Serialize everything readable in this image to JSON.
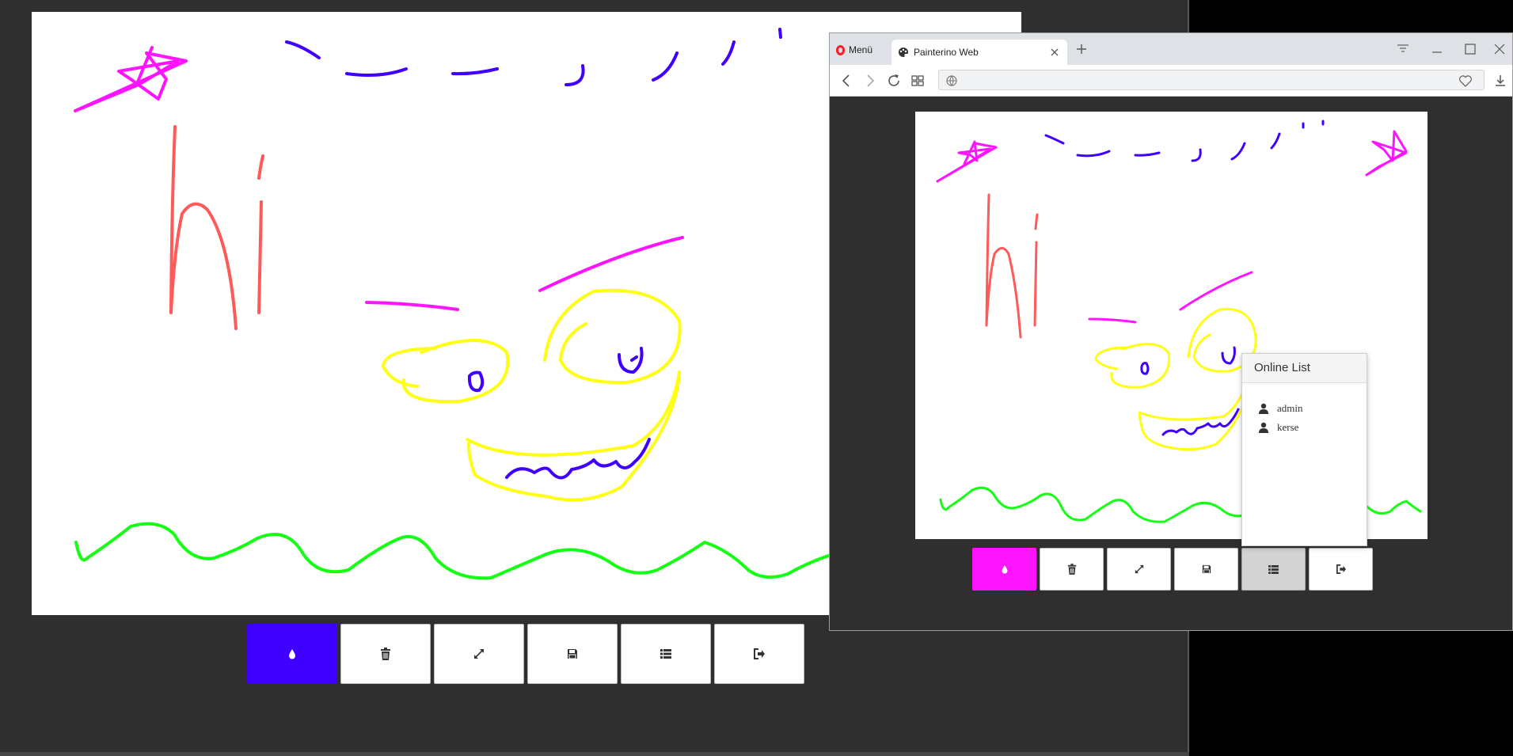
{
  "theme": {
    "left_accent": "#4000ff",
    "right_accent": "#ff14ff",
    "app_background": "#2f2f2f",
    "canvas_background": "#ffffff"
  },
  "left_app": {
    "toolbar": [
      {
        "icon": "ink-drop-icon",
        "name": "color-button",
        "state": "active"
      },
      {
        "icon": "trash-icon",
        "name": "clear-button",
        "state": "normal"
      },
      {
        "icon": "expand-icon",
        "name": "fullscreen-button",
        "state": "normal"
      },
      {
        "icon": "floppy-disk-icon",
        "name": "save-button",
        "state": "normal"
      },
      {
        "icon": "list-icon",
        "name": "online-list-button",
        "state": "normal"
      },
      {
        "icon": "logout-icon",
        "name": "logout-button",
        "state": "normal"
      }
    ],
    "drawing": {
      "handwritten_text": "hi",
      "stroke_colors": [
        "#ff14ff",
        "#4000ff",
        "#ff5a5a",
        "#ffff14",
        "#14ff14"
      ]
    }
  },
  "browser": {
    "menu_label": "Menü",
    "tab_title": "Painterino Web",
    "address_value": "",
    "address_placeholder": "",
    "icons": {
      "back": "back-arrow-icon",
      "forward": "forward-arrow-icon",
      "reload": "reload-icon",
      "speed_dial": "grid-icon",
      "site": "globe-icon",
      "bookmark": "heart-icon",
      "downloads": "download-icon"
    }
  },
  "right_app": {
    "toolbar": [
      {
        "icon": "ink-drop-icon",
        "name": "color-button",
        "state": "active"
      },
      {
        "icon": "trash-icon",
        "name": "clear-button",
        "state": "normal"
      },
      {
        "icon": "expand-icon",
        "name": "fullscreen-button",
        "state": "normal"
      },
      {
        "icon": "floppy-disk-icon",
        "name": "save-button",
        "state": "normal"
      },
      {
        "icon": "list-icon",
        "name": "online-list-button",
        "state": "pressed"
      },
      {
        "icon": "logout-icon",
        "name": "logout-button",
        "state": "normal"
      }
    ],
    "online_list": {
      "title": "Online List",
      "users": [
        "admin",
        "kerse"
      ]
    }
  }
}
